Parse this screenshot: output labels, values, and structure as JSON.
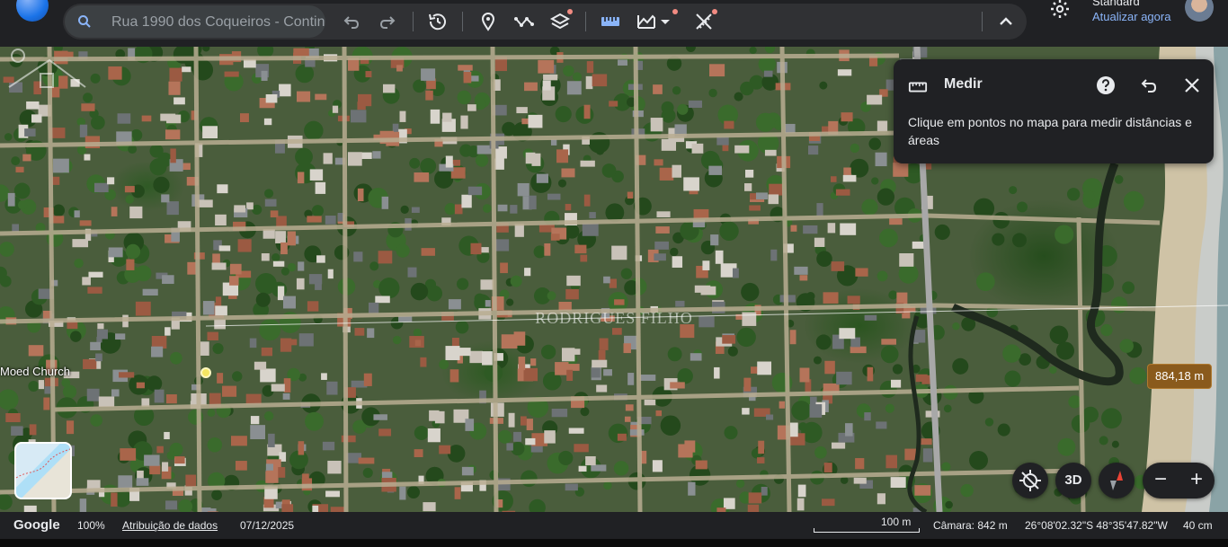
{
  "toolbar": {
    "search_value": "Rua 1990 dos Coqueiros - Contin",
    "icons": [
      "search-icon",
      "undo-icon",
      "redo-icon",
      "history-icon",
      "place-marker-icon",
      "path-icon",
      "layers-icon",
      "ruler-icon",
      "elevation-icon",
      "chevron-down-icon",
      "measure-tool-icon",
      "chevron-up-icon"
    ]
  },
  "account": {
    "map_style": "Standard",
    "sync_status": "Atualizar agora"
  },
  "measure_panel": {
    "title": "Medir",
    "description": "Clique em pontos no mapa para medir distâncias e áreas"
  },
  "map": {
    "place_label": "Moed Church",
    "watermark": "RODRIGUES FILHO",
    "distance": "884,18 m"
  },
  "controls": {
    "view_3d": "3D",
    "zoom_out": "−",
    "zoom_in": "+"
  },
  "status": {
    "brand": "Google",
    "zoom": "100%",
    "attribution": "Atribuição de dados",
    "date": "07/12/2025",
    "scale": "100 m",
    "camera": "Câmara: 842 m",
    "coordinates": "26°08'02.32\"S 48°35'47.82\"W",
    "elevation": "40 cm"
  },
  "colors": {
    "toolbar_bg": "#202124",
    "accent_blue": "#8ab4f8",
    "distance_badge": "#8a5a1c",
    "notification_dot": "#f28b82"
  }
}
